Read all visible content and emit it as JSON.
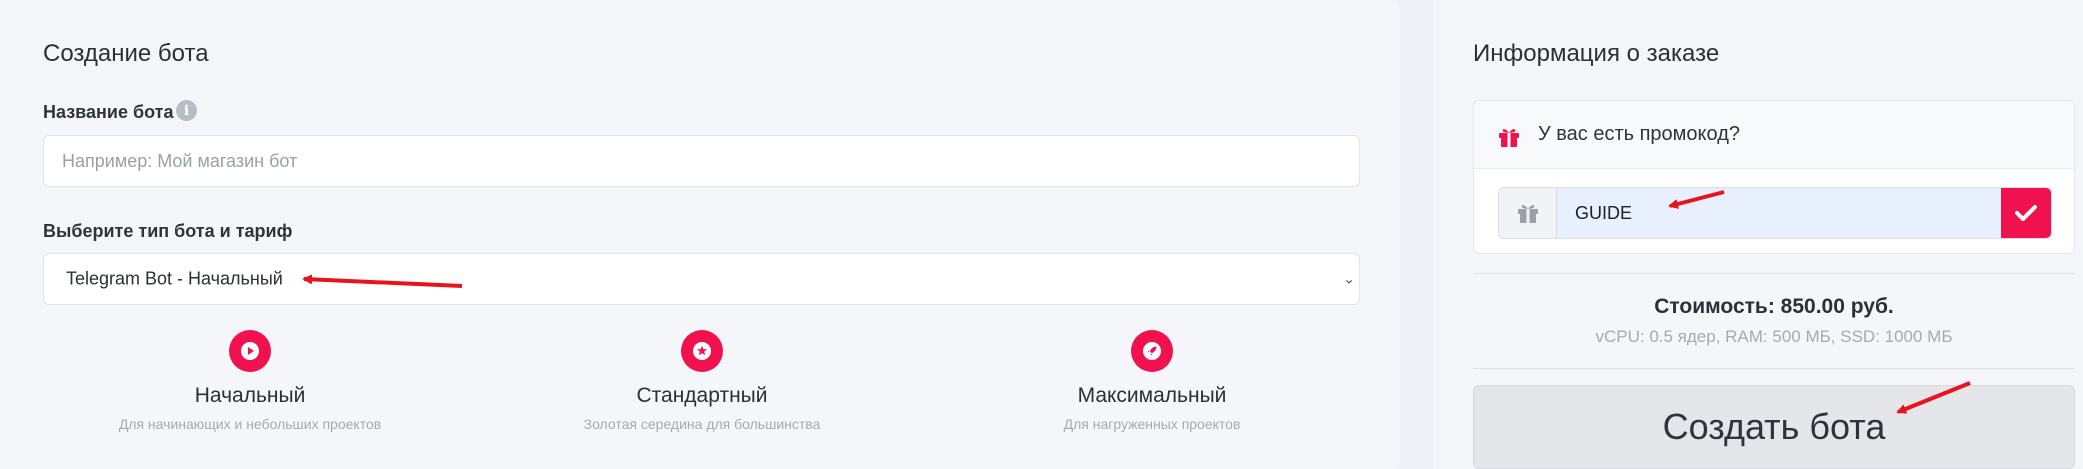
{
  "bot_creation": {
    "title": "Создание бота",
    "name_label": "Название бота",
    "name_placeholder": "Например: Мой магазин бот",
    "name_value": "",
    "type_label": "Выберите тип бота и тариф",
    "type_selected": "Telegram Bot - Начальный"
  },
  "tiers": [
    {
      "icon": "play-icon",
      "name": "Начальный",
      "desc": "Для начинающих и небольших проектов"
    },
    {
      "icon": "star-icon",
      "name": "Стандартный",
      "desc": "Золотая середина для большинства"
    },
    {
      "icon": "rocket-icon",
      "name": "Максимальный",
      "desc": "Для нагруженных проектов"
    }
  ],
  "order_info": {
    "title": "Информация о заказе",
    "promo_question": "У вас есть промокод?",
    "promo_value": "GUIDE",
    "cost": "Стоимость: 850.00 руб.",
    "specs": "vCPU: 0.5 ядер, RAM: 500 МБ, SSD: 1000 МБ",
    "create_button": "Создать бота"
  },
  "colors": {
    "accent": "#f0124f",
    "annotation_arrow": "#e8131b"
  }
}
